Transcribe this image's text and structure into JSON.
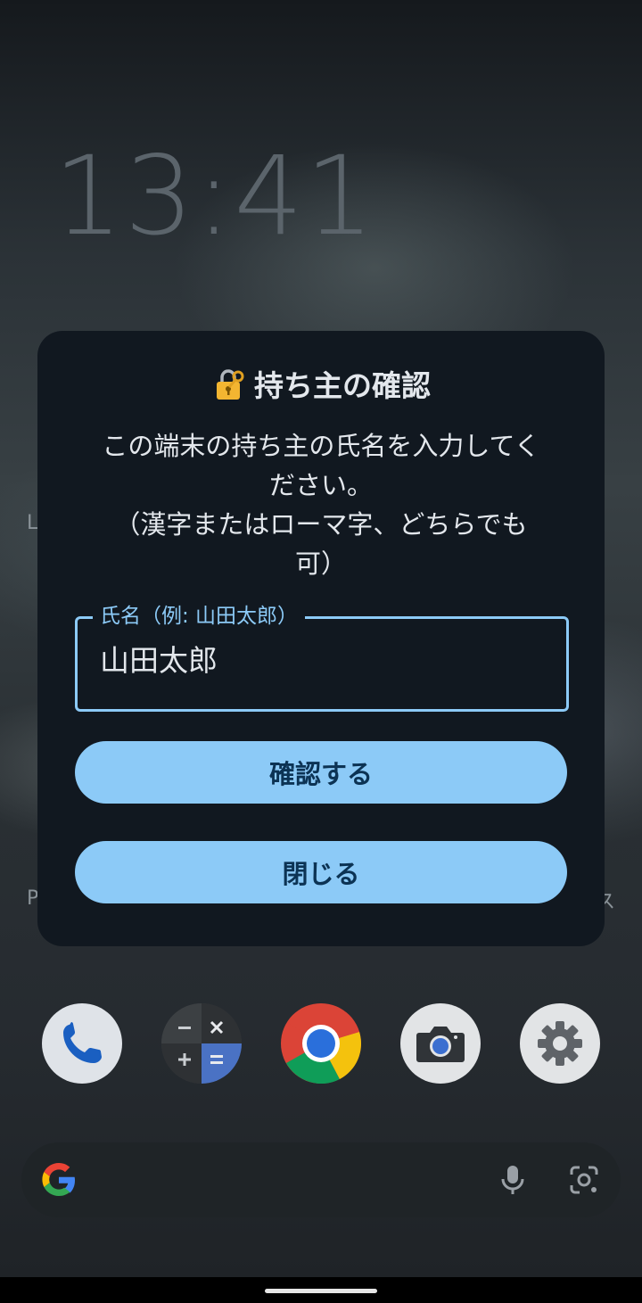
{
  "lockscreen": {
    "clock": "13:41",
    "edge_text_left_1": "L",
    "edge_text_left_2": "P",
    "edge_text_right_2": "ス"
  },
  "dialog": {
    "title": "持ち主の確認",
    "title_icon": "lock-with-key-icon",
    "body": "この端末の持ち主の氏名を入力してく\nださい。\n（漢字またはローマ字、どちらでも\n可）",
    "name_field": {
      "label": "氏名（例: 山田太郎）",
      "value": "山田太郎"
    },
    "confirm_label": "確認する",
    "close_label": "閉じる"
  },
  "dock": {
    "apps": [
      "phone-icon",
      "calculator-icon",
      "chrome-icon",
      "camera-icon",
      "settings-icon"
    ]
  },
  "search": {
    "icons": [
      "google-g-icon",
      "microphone-icon",
      "lens-icon"
    ]
  },
  "colors": {
    "dialog_bg": "#111820",
    "accent": "#8ccaf7",
    "button_text": "#0c3354",
    "text": "#e3e7ec"
  }
}
